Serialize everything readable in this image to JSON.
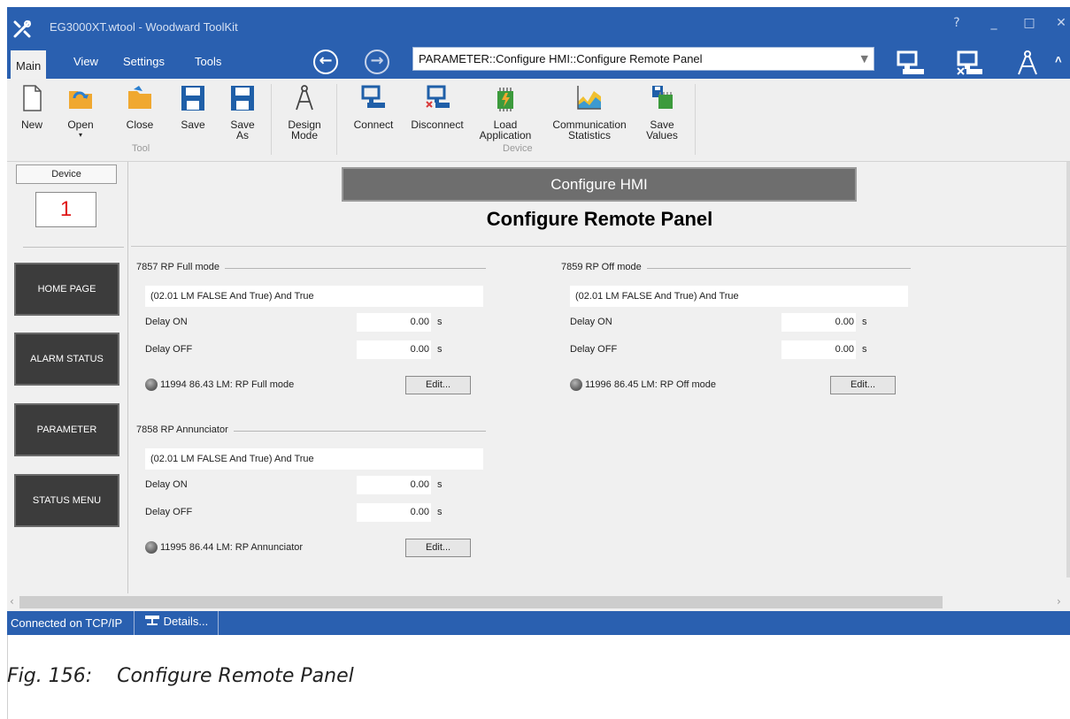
{
  "window": {
    "title": "EG3000XT.wtool - Woodward ToolKit",
    "help": "?",
    "minimize": "_",
    "maximize": "□",
    "close": "✕",
    "accent": "#2a60b0"
  },
  "menu": {
    "items": [
      "Main",
      "View",
      "Settings",
      "Tools"
    ],
    "back_glyph": "←",
    "forward_glyph": "→",
    "path": "PARAMETER::Configure HMI::Configure Remote Panel",
    "dropdown_glyph": "▼",
    "collapse_glyph": "˄",
    "right_icons": [
      "connect-icon",
      "disconnect-icon",
      "design-mode-icon"
    ]
  },
  "ribbon": {
    "tool_buttons": [
      {
        "label": "New",
        "icon": "new-file-icon"
      },
      {
        "label": "Open",
        "icon": "open-folder-icon"
      },
      {
        "label": "Close",
        "icon": "close-folder-icon"
      },
      {
        "label": "Save",
        "icon": "save-icon"
      },
      {
        "label": "Save As",
        "icon": "save-as-icon"
      }
    ],
    "tool_group_label": "Tool",
    "design_mode": {
      "label": "Design Mode",
      "icon": "design-mode-icon"
    },
    "device_buttons": [
      {
        "label": "Connect",
        "icon": "connect-icon"
      },
      {
        "label": "Disconnect",
        "icon": "disconnect-icon"
      },
      {
        "label": "Load Application",
        "icon": "load-application-icon"
      },
      {
        "label": "Communication Statistics",
        "icon": "statistics-icon"
      },
      {
        "label": "Save Values",
        "icon": "save-values-icon"
      }
    ],
    "device_group_label": "Device"
  },
  "left_panel": {
    "device_label": "Device",
    "device_number": "1",
    "nav_buttons": [
      "HOME PAGE",
      "ALARM STATUS",
      "PARAMETER",
      "STATUS MENU"
    ]
  },
  "main": {
    "banner": "Configure HMI",
    "title": "Configure Remote Panel",
    "groups": [
      {
        "header": "7857 RP Full mode",
        "expression": "(02.01 LM FALSE And True) And True",
        "delay_on_label": "Delay ON",
        "delay_on_value": "0.00",
        "delay_off_label": "Delay OFF",
        "delay_off_value": "0.00",
        "unit": "s",
        "status": "11994 86.43 LM: RP Full mode",
        "edit_label": "Edit..."
      },
      {
        "header": "7859 RP Off mode",
        "expression": "(02.01 LM FALSE And True) And True",
        "delay_on_label": "Delay ON",
        "delay_on_value": "0.00",
        "delay_off_label": "Delay OFF",
        "delay_off_value": "0.00",
        "unit": "s",
        "status": "11996 86.45 LM: RP Off mode",
        "edit_label": "Edit..."
      },
      {
        "header": "7858 RP Annunciator",
        "expression": "(02.01 LM FALSE And True) And True",
        "delay_on_label": "Delay ON",
        "delay_on_value": "0.00",
        "delay_off_label": "Delay OFF",
        "delay_off_value": "0.00",
        "unit": "s",
        "status": "11995 86.44 LM: RP Annunciator",
        "edit_label": "Edit..."
      }
    ]
  },
  "statusbar": {
    "connection": "Connected on TCP/IP",
    "details": "Details..."
  },
  "caption": "Fig. 156:    Configure Remote Panel"
}
